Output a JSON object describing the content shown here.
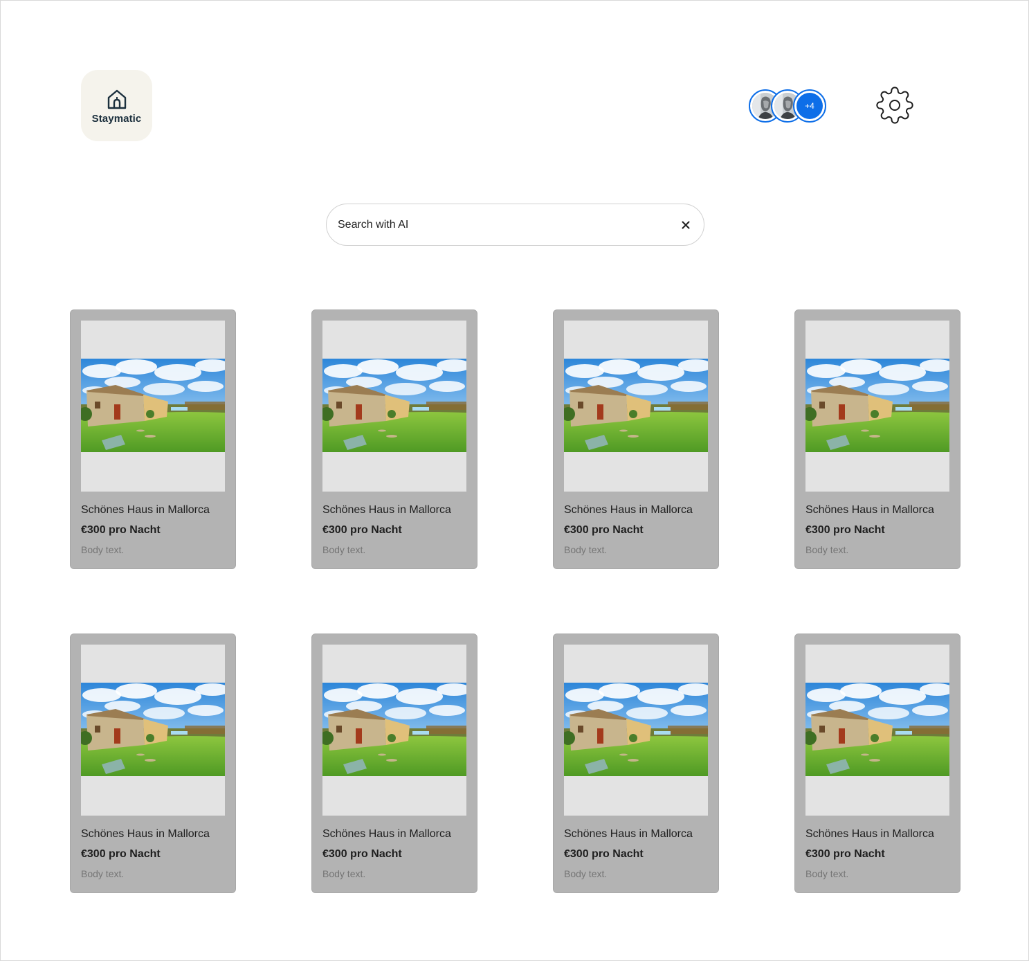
{
  "header": {
    "logo_text": "Staymatic",
    "avatars_more": "+4",
    "accent_color": "#0d6ee8"
  },
  "search": {
    "placeholder": "Search with AI",
    "clear_icon": "close-icon"
  },
  "listings": [
    {
      "title": "Schönes Haus in Mallorca",
      "price": "€300 pro Nacht",
      "body": "Body text."
    },
    {
      "title": "Schönes Haus in Mallorca",
      "price": "€300 pro Nacht",
      "body": "Body text."
    },
    {
      "title": "Schönes Haus in Mallorca",
      "price": "€300 pro Nacht",
      "body": "Body text."
    },
    {
      "title": "Schönes Haus in Mallorca",
      "price": "€300 pro Nacht",
      "body": "Body text."
    },
    {
      "title": "Schönes Haus in Mallorca",
      "price": "€300 pro Nacht",
      "body": "Body text."
    },
    {
      "title": "Schönes Haus in Mallorca",
      "price": "€300 pro Nacht",
      "body": "Body text."
    },
    {
      "title": "Schönes Haus in Mallorca",
      "price": "€300 pro Nacht",
      "body": "Body text."
    },
    {
      "title": "Schönes Haus in Mallorca",
      "price": "€300 pro Nacht",
      "body": "Body text."
    }
  ]
}
